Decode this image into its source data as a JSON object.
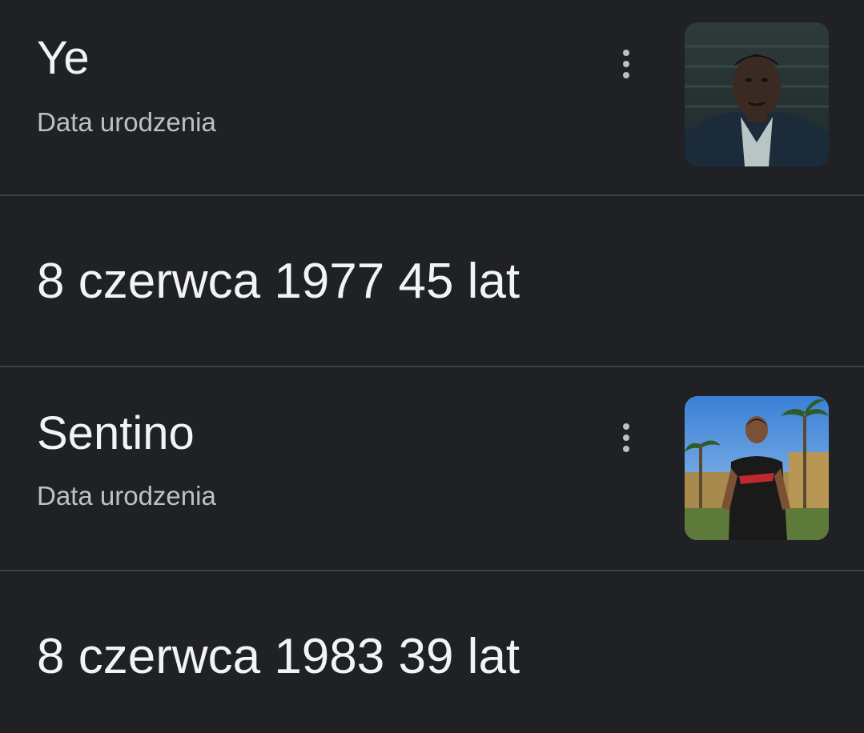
{
  "entries": [
    {
      "name": "Ye",
      "label": "Data urodzenia",
      "birth_date": "8 czerwca 1977",
      "age": "45 lat",
      "thumbnail_icon": "person-portrait"
    },
    {
      "name": "Sentino",
      "label": "Data urodzenia",
      "birth_date": "8 czerwca 1983",
      "age": "39 lat",
      "thumbnail_icon": "person-outdoor-photo"
    }
  ],
  "colors": {
    "background": "#202124",
    "divider": "#3c4043",
    "primary_text": "#f1f3f4",
    "secondary_text": "#bdc1c6"
  }
}
